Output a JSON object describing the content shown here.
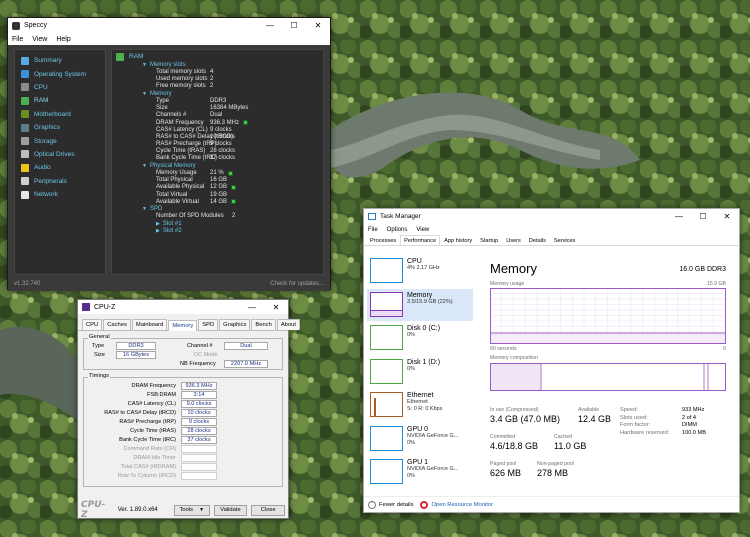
{
  "speccy": {
    "title": "Speccy",
    "menu": [
      "File",
      "View",
      "Help"
    ],
    "sidebar": [
      {
        "label": "Summary",
        "icon": "summary-icon",
        "color": "#5aa9e0"
      },
      {
        "label": "Operating System",
        "icon": "windows-icon",
        "color": "#3e8fd4"
      },
      {
        "label": "CPU",
        "icon": "cpu-icon",
        "color": "#8a8a8a"
      },
      {
        "label": "RAM",
        "icon": "ram-icon",
        "color": "#4caf50"
      },
      {
        "label": "Motherboard",
        "icon": "motherboard-icon",
        "color": "#6b8e23"
      },
      {
        "label": "Graphics",
        "icon": "graphics-icon",
        "color": "#607d8b"
      },
      {
        "label": "Storage",
        "icon": "storage-icon",
        "color": "#9e9e9e"
      },
      {
        "label": "Optical Drives",
        "icon": "optical-drive-icon",
        "color": "#bdbdbd"
      },
      {
        "label": "Audio",
        "icon": "audio-icon",
        "color": "#f0c419"
      },
      {
        "label": "Peripherals",
        "icon": "peripherals-icon",
        "color": "#cfcfcf"
      },
      {
        "label": "Network",
        "icon": "network-icon",
        "color": "#e6e6e6"
      }
    ],
    "main": {
      "heading": "RAM",
      "slots_title": "Memory slots",
      "slots": [
        {
          "k": "Total memory slots",
          "v": "4"
        },
        {
          "k": "Used memory slots",
          "v": "2"
        },
        {
          "k": "Free memory slots",
          "v": "2"
        }
      ],
      "memory_title": "Memory",
      "memory": [
        {
          "k": "Type",
          "v": "DDR3"
        },
        {
          "k": "Size",
          "v": "16384 MBytes"
        },
        {
          "k": "Channels #",
          "v": "Dual"
        },
        {
          "k": "DRAM Frequency",
          "v": "936.3 MHz"
        },
        {
          "k": "CAS# Latency (CL)",
          "v": "9 clocks"
        },
        {
          "k": "RAS# to CAS# Delay (tRCD)",
          "v": "10 clocks"
        },
        {
          "k": "RAS# Precharge (tRP)",
          "v": "9 clocks"
        },
        {
          "k": "Cycle Time (tRAS)",
          "v": "28 clocks"
        },
        {
          "k": "Bank Cycle Time (tRC)",
          "v": "37 clocks"
        }
      ],
      "physical_title": "Physical Memory",
      "physical": [
        {
          "k": "Memory Usage",
          "v": "21 %"
        },
        {
          "k": "Total Physical",
          "v": "16 GB"
        },
        {
          "k": "Available Physical",
          "v": "12 GB"
        },
        {
          "k": "Total Virtual",
          "v": "19 GB"
        },
        {
          "k": "Available Virtual",
          "v": "14 GB"
        }
      ],
      "spd_title": "SPD",
      "spd_modules_label": "Number Of SPD Modules",
      "spd_modules_value": "2",
      "slot1": "Slot #1",
      "slot2": "Slot #2"
    },
    "version": "v1.32.740",
    "check_updates": "Check for updates..."
  },
  "cpuz": {
    "title": "CPU-Z",
    "tabs": [
      "CPU",
      "Caches",
      "Mainboard",
      "Memory",
      "SPD",
      "Graphics",
      "Bench",
      "About"
    ],
    "general_label": "General",
    "type_label": "Type",
    "type_value": "DDR3",
    "size_label": "Size",
    "size_value": "16 GBytes",
    "channel_label": "Channel #",
    "channel_value": "Dual",
    "dcmode_label": "DC Mode",
    "nbfreq_label": "NB Frequency",
    "nbfreq_value": "2207.0 MHz",
    "timings_label": "Timings",
    "timings": [
      {
        "k": "DRAM Frequency",
        "v": "936.3 MHz"
      },
      {
        "k": "FSB:DRAM",
        "v": "3:14"
      },
      {
        "k": "CAS# Latency (CL)",
        "v": "9.0 clocks"
      },
      {
        "k": "RAS# to CAS# Delay (tRCD)",
        "v": "10 clocks"
      },
      {
        "k": "RAS# Precharge (tRP)",
        "v": "9 clocks"
      },
      {
        "k": "Cycle Time (tRAS)",
        "v": "28 clocks"
      },
      {
        "k": "Bank Cycle Time (tRC)",
        "v": "37 clocks"
      }
    ],
    "timings_disabled": [
      "Command Rate (CR)",
      "DRAM Idle Timer",
      "Total CAS# (tRDRAM)",
      "Row To Column (tRCD)"
    ],
    "logo": "CPU-Z",
    "version": "Ver. 1.89.0.x64",
    "tools": "Tools",
    "validate": "Validate",
    "close": "Close"
  },
  "taskmgr": {
    "title": "Task Manager",
    "menu": [
      "File",
      "Options",
      "View"
    ],
    "tabs": [
      "Processes",
      "Performance",
      "App history",
      "Startup",
      "Users",
      "Details",
      "Services"
    ],
    "devices": [
      {
        "name": "CPU",
        "sub1": "4% 2.17 GHz",
        "sub2": "",
        "color": "#1f8dd6"
      },
      {
        "name": "Memory",
        "sub1": "3.5/15.9 GB (22%)",
        "sub2": "",
        "color": "#8b34b8"
      },
      {
        "name": "Disk 0 (C:)",
        "sub1": "0%",
        "sub2": "",
        "color": "#4da843"
      },
      {
        "name": "Disk 1 (D:)",
        "sub1": "0%",
        "sub2": "",
        "color": "#4da843"
      },
      {
        "name": "Ethernet",
        "sub1": "Ethernet",
        "sub2": "S: 0 R: 0 Kbps",
        "color": "#a75d24"
      },
      {
        "name": "GPU 0",
        "sub1": "NVIDIA GeForce G...",
        "sub2": "0%",
        "color": "#1f8dd6"
      },
      {
        "name": "GPU 1",
        "sub1": "NVIDIA GeForce G...",
        "sub2": "0%",
        "color": "#1f8dd6"
      }
    ],
    "perf": {
      "title": "Memory",
      "total": "16.0 GB DDR3",
      "usage_label": "Memory usage",
      "usage_max": "15.9 GB",
      "seconds": "60 seconds",
      "zero": "0",
      "composition_label": "Memory composition",
      "in_use_label": "In use (Compressed)",
      "in_use_value": "3.4 GB (47.0 MB)",
      "available_label": "Available",
      "available_value": "12.4 GB",
      "committed_label": "Committed",
      "committed_value": "4.6/18.8 GB",
      "cached_label": "Cached",
      "cached_value": "11.0 GB",
      "paged_label": "Paged pool",
      "paged_value": "626 MB",
      "nonpaged_label": "Non-paged pool",
      "nonpaged_value": "278 MB",
      "specs": [
        {
          "k": "Speed:",
          "v": "933 MHz"
        },
        {
          "k": "Slots used:",
          "v": "2 of 4"
        },
        {
          "k": "Form factor:",
          "v": "DIMM"
        },
        {
          "k": "Hardware reserved:",
          "v": "100.0 MB"
        }
      ],
      "accent": "#8b34b8"
    },
    "fewer_details": "Fewer details",
    "open_resmon": "Open Resource Monitor"
  }
}
